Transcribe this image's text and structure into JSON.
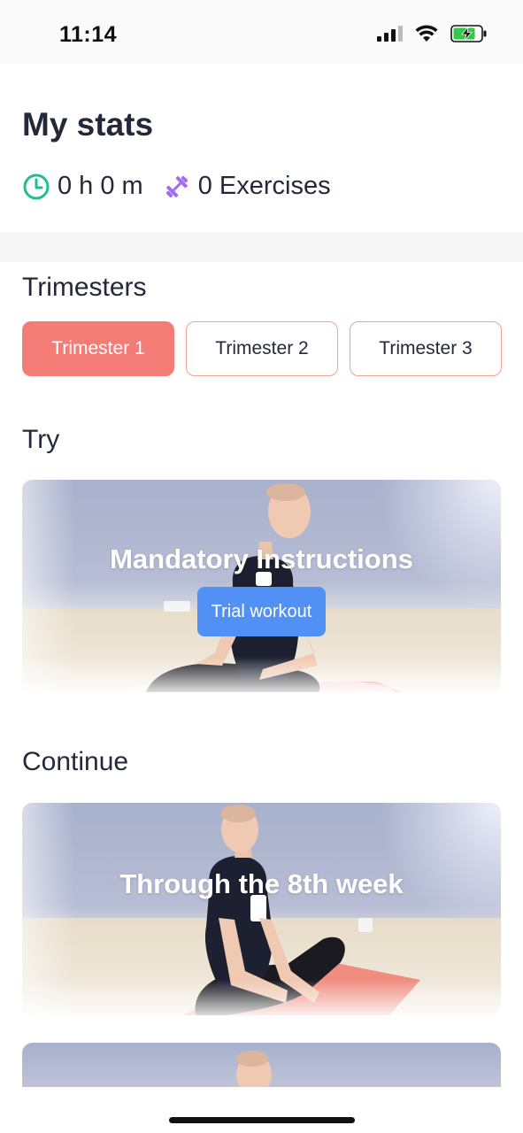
{
  "status_bar": {
    "time": "11:14"
  },
  "stats": {
    "title": "My stats",
    "time_value": "0 h 0 m",
    "exercises_value": "0 Exercises",
    "icons": {
      "time": "clock-icon",
      "exercises": "dumbbell-icon"
    },
    "colors": {
      "clock": "#1fbf8f",
      "dumbbell": "#a06cf0"
    }
  },
  "trimesters": {
    "heading": "Trimesters",
    "options": [
      "Trimester 1",
      "Trimester 2",
      "Trimester 3"
    ],
    "selected": "Trimester 1",
    "colors": {
      "active_bg": "#f47c76",
      "border": "#f0a293"
    }
  },
  "try": {
    "heading": "Try",
    "card_title": "Mandatory Instructions",
    "button_label": "Trial workout",
    "button_color": "#5191f5"
  },
  "continue": {
    "heading": "Continue",
    "card_title": "Through the 8th week"
  }
}
